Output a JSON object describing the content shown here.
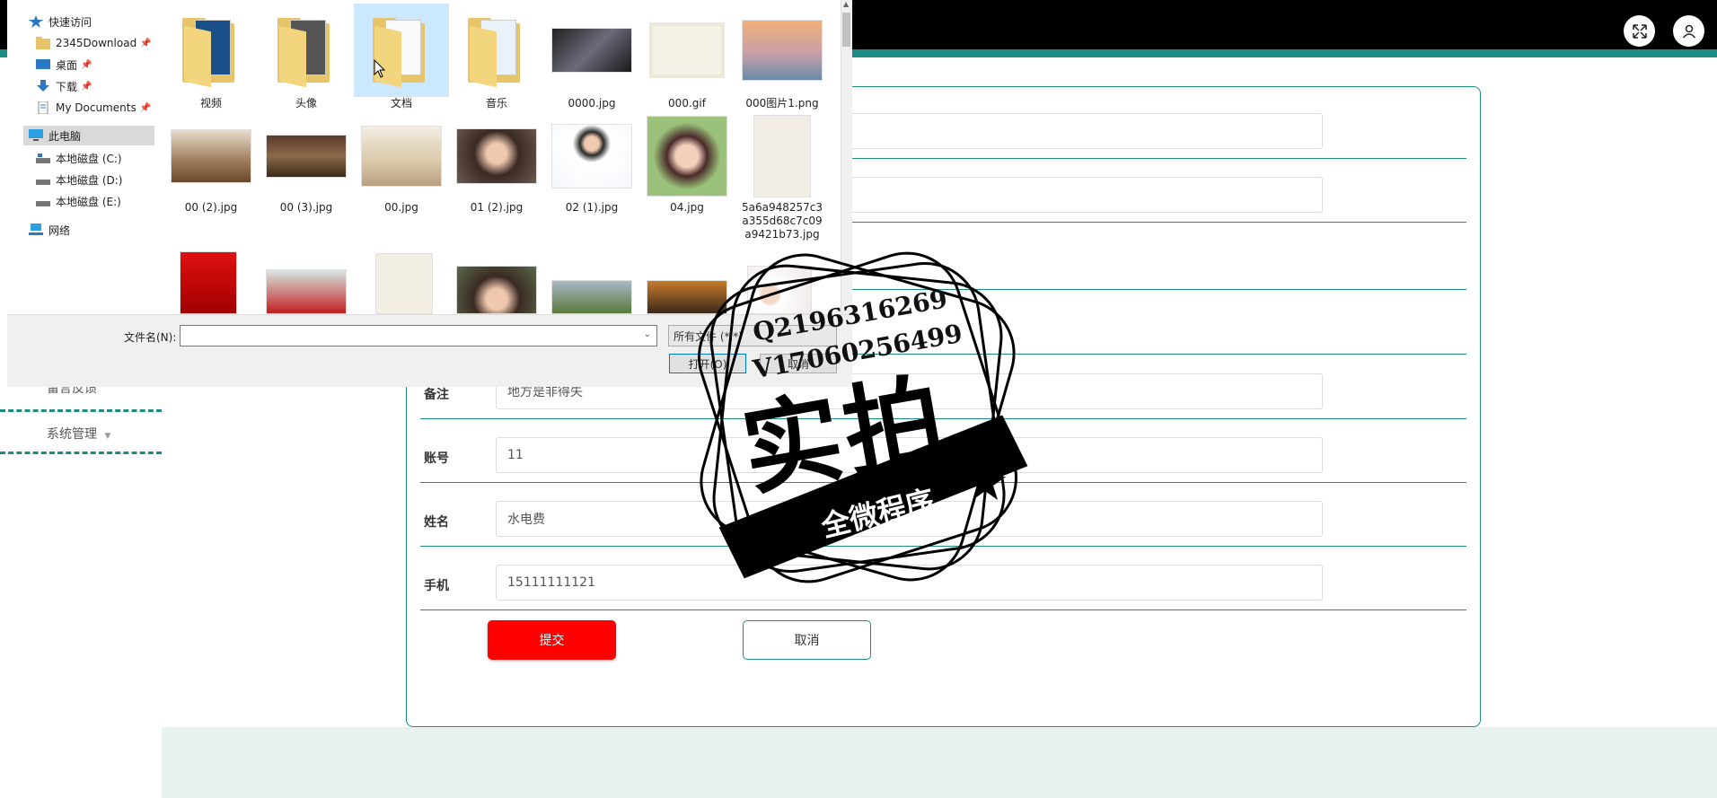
{
  "dialog": {
    "nav": {
      "quick_access": "快速访问",
      "items": [
        "2345Download",
        "桌面",
        "下载",
        "My Documents"
      ],
      "this_pc": "此电脑",
      "drives": [
        "本地磁盘 (C:)",
        "本地磁盘 (D:)",
        "本地磁盘 (E:)"
      ],
      "network": "网络"
    },
    "files": [
      {
        "name": "视频"
      },
      {
        "name": "头像"
      },
      {
        "name": "文档"
      },
      {
        "name": "音乐"
      },
      {
        "name": "0000.jpg"
      },
      {
        "name": "000.gif"
      },
      {
        "name": "000图片1.png"
      },
      {
        "name": "00 (2).jpg"
      },
      {
        "name": "00 (3).jpg"
      },
      {
        "name": "00.jpg"
      },
      {
        "name": "01 (2).jpg"
      },
      {
        "name": "02 (1).jpg"
      },
      {
        "name": "04.jpg"
      },
      {
        "name": "5a6a948257c3a355d68c7c09a9421b73.jpg"
      }
    ],
    "filename_label": "文件名(N):",
    "filename_value": "",
    "filetype_value": "所有文件 (*.*)",
    "open_label": "打开(O)",
    "cancel_label": "取消"
  },
  "app": {
    "sidebar": {
      "items": [
        "留言反馈",
        "系统管理"
      ]
    },
    "form": {
      "fields": [
        {
          "label": "备注",
          "value": "地方是非得失"
        },
        {
          "label": "账号",
          "value": "11"
        },
        {
          "label": "姓名",
          "value": "水电费"
        },
        {
          "label": "手机",
          "value": "15111111121"
        }
      ],
      "submit_label": "提交",
      "cancel_label": "取消"
    }
  },
  "watermark": {
    "qq": "Q2196316269",
    "wechat": "V17060256499",
    "main": "实拍",
    "banner": "全微程序"
  },
  "colors": {
    "accent": "#1a8c84",
    "submit": "#ff0000",
    "topbar": "#000000",
    "selection": "#cce8ff"
  }
}
